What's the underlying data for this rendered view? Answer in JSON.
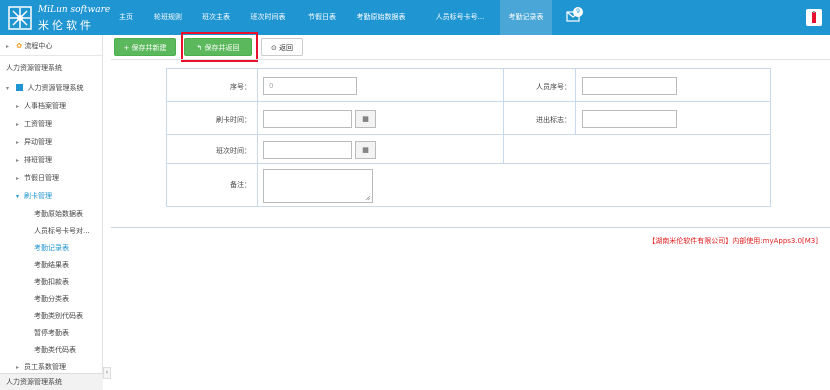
{
  "brand": {
    "english": "MiLun software",
    "chinese": "米伦软件",
    "accent": "#1f95d2"
  },
  "nav": [
    {
      "label": "主页"
    },
    {
      "label": "轮班规则"
    },
    {
      "label": "班次主表"
    },
    {
      "label": "班次时间表"
    },
    {
      "label": "节假日表"
    },
    {
      "label": "考勤原始数据表"
    },
    {
      "label": "人员标号卡号..."
    },
    {
      "label": "考勤记录表",
      "active": true
    }
  ],
  "notifications": {
    "icon": "message-icon",
    "count": "9"
  },
  "sidebar": {
    "workflow": "流程中心",
    "section_title": "人力资源管理系统",
    "system": "人力资源管理系统",
    "groups": [
      "人事档案管理",
      "工资管理",
      "异动管理",
      "排班管理",
      "节假日管理",
      "刷卡管理"
    ],
    "children": [
      "考勤原始数据表",
      "人员标号卡号对...",
      "考勤记录表",
      "考勤结果表",
      "考勤扣款表",
      "考勤分类表",
      "考勤类别代码表",
      "暂停考勤表",
      "考勤类代码表"
    ],
    "active_child_index": 2,
    "last_group": "员工系数管理",
    "bottom": "人力资源管理系统",
    "scroll_arrow": "‹"
  },
  "toolbar": {
    "save_new": "+ 保存并新建",
    "save_return": "↰ 保存并返回",
    "back": "⊙ 返回"
  },
  "form": {
    "serial_label": "序号：",
    "serial_value": "0",
    "person_serial_label": "人员序号：",
    "person_serial_value": "",
    "swipe_time_label": "刷卡时间：",
    "swipe_time_value": "",
    "in_out_label": "进出标志：",
    "in_out_value": "",
    "shift_time_label": "班次时间：",
    "shift_time_value": "",
    "remark_label": "备注：",
    "remark_value": "",
    "calendar_glyph": "▦"
  },
  "footer": {
    "text": "【湖南米伦软件有限公司】内部使用:myApps3.0[M3]",
    "color": "#e02020"
  }
}
